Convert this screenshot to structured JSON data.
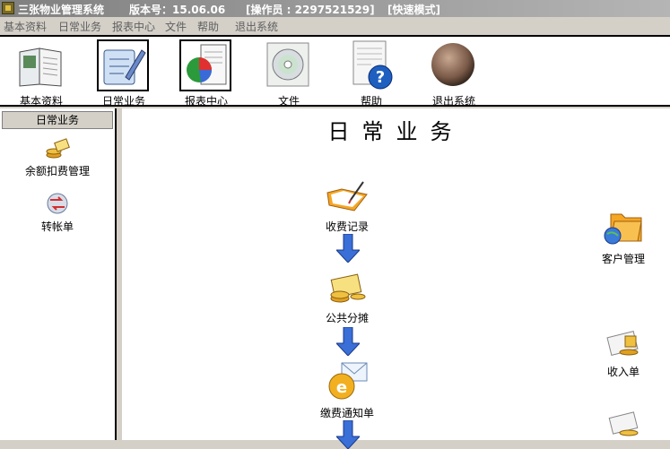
{
  "titlebar": {
    "app_name": "三张物业管理系统",
    "version": "版本号：15.06.06",
    "operator": "[操作员 : 2297521529]",
    "mode": "[快速模式]"
  },
  "menu": [
    "基本资料",
    "日常业务",
    "报表中心",
    "文件",
    "帮助",
    "退出系统"
  ],
  "toolbar": [
    {
      "label": "基本资料",
      "icon": "book-icon",
      "pressed": false
    },
    {
      "label": "日常业务",
      "icon": "clipboard-pen-icon",
      "pressed": true
    },
    {
      "label": "报表中心",
      "icon": "pie-chart-report-icon",
      "pressed": true
    },
    {
      "label": "文件",
      "icon": "cd-disc-icon",
      "pressed": false
    },
    {
      "label": "帮助",
      "icon": "help-question-icon",
      "pressed": false
    },
    {
      "label": "退出系统",
      "icon": "exit-sphere-icon",
      "pressed": false
    }
  ],
  "sidebar": {
    "header": "日常业务",
    "items": [
      {
        "label": "余额扣费管理",
        "icon": "money-deduct-icon"
      },
      {
        "label": "转帐单",
        "icon": "transfer-bill-icon"
      }
    ]
  },
  "main": {
    "heading": "日常业务",
    "flow": [
      {
        "label": "收费记录",
        "icon": "folder-pen-icon"
      },
      {
        "label": "公共分摊",
        "icon": "coins-share-icon"
      },
      {
        "label": "缴费通知单",
        "icon": "email-notice-icon"
      }
    ],
    "side": [
      {
        "label": "客户管理",
        "icon": "customer-folder-globe-icon"
      },
      {
        "label": "收入单",
        "icon": "income-bill-icon"
      }
    ],
    "colors": {
      "arrow": "#3a6fd8",
      "folder": "#f5a623"
    }
  }
}
